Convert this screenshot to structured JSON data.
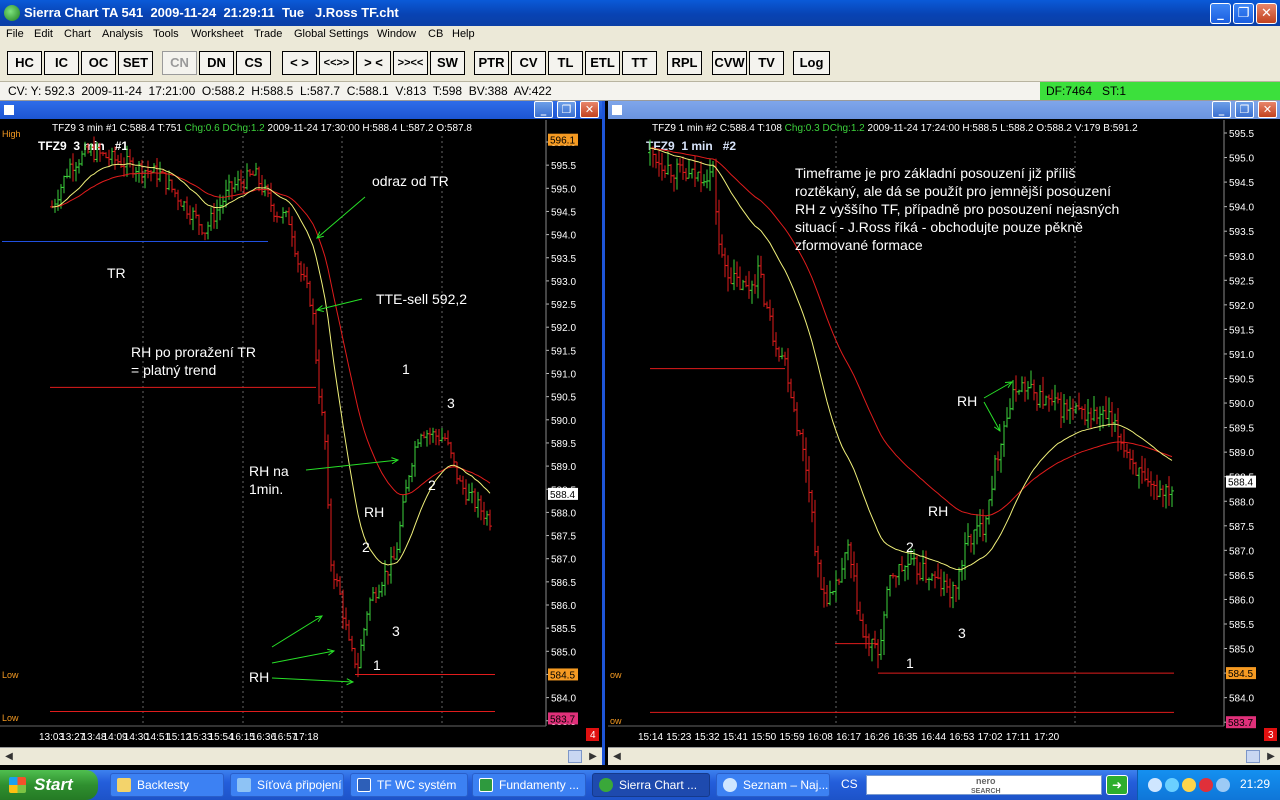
{
  "window": {
    "title": "Sierra Chart TA 541  2009-11-24  21:29:11  Tue   J.Ross TF.cht",
    "minimize": "_",
    "maximize": "❐",
    "close": "✕"
  },
  "menu": [
    "File",
    "Edit",
    "Chart",
    "Analysis",
    "Tools",
    "Worksheet",
    "Trade",
    "Global Settings",
    "Window",
    "CB",
    "Help"
  ],
  "toolbar": [
    "HC",
    "IC",
    "OC",
    "SET",
    "CN",
    "DN",
    "CS",
    "< >",
    "<<>>",
    "> <",
    ">><<",
    "SW",
    "PTR",
    "CV",
    "TL",
    "ETL",
    "TT",
    "RPL",
    "CVW",
    "TV",
    "Log"
  ],
  "status": {
    "left": "CV: Y: 592.3  2009-11-24  17:21:00  O:588.2  H:588.5  L:587.7  C:588.1  V:813  T:598  BV:388  AV:422",
    "right": "DF:7464   ST:1"
  },
  "chart1": {
    "title": "TFZ9  3 min   #1",
    "header": "TFZ9  3 min   #1  C:588.4  T:751",
    "chg": "Chg:0.6",
    "dchg": "DChg:1.2",
    "header_rest": "2009-11-24   17:30:00   H:588.4   L:587.2   O:587.8",
    "high_label": "High",
    "low_label": "Low",
    "low2_label": "Low",
    "top_tag": "596.1",
    "last_tag": "588.4",
    "low_tag": "584.5",
    "bottom_tag": "583.7",
    "badge": "4",
    "price_labels": [
      "596.0",
      "595.5",
      "595.0",
      "594.5",
      "594.0",
      "593.5",
      "593.0",
      "592.5",
      "592.0",
      "591.5",
      "591.0",
      "590.5",
      "590.0",
      "589.5",
      "589.0",
      "588.5",
      "588.0",
      "587.5",
      "587.0",
      "586.5",
      "586.0",
      "585.5",
      "585.0",
      "584.5",
      "584.0",
      "583.5"
    ],
    "time_labels": [
      "13:03",
      "13:27",
      "13:48",
      "14:09",
      "14:30",
      "14:51",
      "15:12",
      "15:33",
      "15:54",
      "16:15",
      "16:36",
      "16:57",
      "17:18"
    ],
    "annotations": {
      "tr": "TR",
      "odraz": "odraz od TR",
      "tte": "TTE-sell 592,2",
      "rh_por1": "RH po proražení TR",
      "rh_por2": "= platný trend",
      "rh_na1": "RH na",
      "rh_na2": "1min.",
      "n1a": "1",
      "n2a": "2",
      "n3a": "3",
      "rh_mid": "RH",
      "n2b": "2",
      "n3b": "3",
      "n1b": "1",
      "rh_bottom": "RH"
    }
  },
  "chart2": {
    "title": "TFZ9  1 min   #2",
    "header": "TFZ9  1 min   #2  C:588.4  T:108",
    "chg": "Chg:0.3",
    "dchg": "DChg:1.2",
    "header_rest": "2009-11-24   17:24:00   H:588.5   L:588.2   O:588.2   V:179   B:591.2",
    "low_label": "ow",
    "low2_label": "ow",
    "top_tag": "595.5",
    "last_tag": "588.4",
    "low_tag": "584.5",
    "bottom_tag": "583.7",
    "badge": "3",
    "price_labels": [
      "595.5",
      "595.0",
      "594.5",
      "594.0",
      "593.5",
      "593.0",
      "592.5",
      "592.0",
      "591.5",
      "591.0",
      "590.5",
      "590.0",
      "589.5",
      "589.0",
      "588.5",
      "588.0",
      "587.5",
      "587.0",
      "586.5",
      "586.0",
      "585.5",
      "585.0",
      "584.5",
      "584.0",
      "583.5"
    ],
    "time_labels": [
      "15:14",
      "15:23",
      "15:32",
      "15:41",
      "15:50",
      "15:59",
      "16:08",
      "16:17",
      "16:26",
      "16:35",
      "16:44",
      "16:53",
      "17:02",
      "17:11",
      "17:20"
    ],
    "note": [
      "Timeframe je pro základní posouzení již příliš",
      "roztěkaný, ale dá se použít pro jemnější posouzení",
      "RH z vyššího TF, případně pro posouzení nejasných",
      "situací - J.Ross říká - obchodujte pouze pěkně",
      "zformované formace"
    ],
    "annotations": {
      "rh_top": "RH",
      "rh_mid": "RH",
      "n2": "2",
      "n3": "3",
      "n1": "1"
    }
  },
  "taskbar": {
    "start": "Start",
    "tasks": [
      "Backtesty",
      "Síťová připojení",
      "TF WC systém",
      "Fundamenty ...",
      "Sierra Chart ...",
      "Seznam – Naj..."
    ],
    "cs": "CS",
    "nero_line1": "nero",
    "nero_line2": "SEARCH",
    "clock": "21:29"
  },
  "colors": {
    "bull": "#3cd23c",
    "bear": "#e01c1c",
    "ema_slow": "#e01c1c",
    "ema_fast": "#f0f07a",
    "annotation_arrow": "#28e028",
    "tag_orange": "#f59a22",
    "tag_pink": "#e0307a",
    "hline_blue": "#2050e0"
  },
  "icons": {
    "app": "sierra-chart-icon",
    "chart_window": "chart-window-icon",
    "start": "windows-flag-icon",
    "folder": "folder-icon",
    "network": "network-icon",
    "word": "word-icon",
    "excel": "excel-icon",
    "browser": "browser-icon"
  }
}
